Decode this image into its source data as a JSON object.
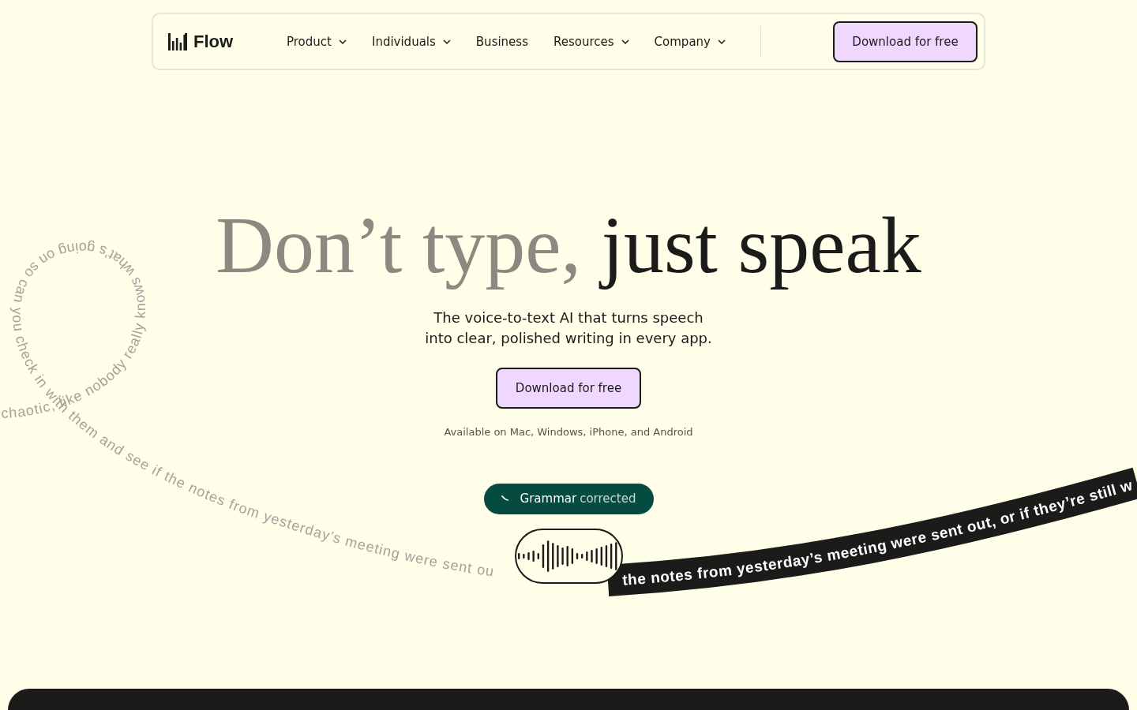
{
  "nav": {
    "logo": "Flow",
    "items": [
      {
        "label": "Product",
        "dropdown": true
      },
      {
        "label": "Individuals",
        "dropdown": true
      },
      {
        "label": "Business",
        "dropdown": false
      },
      {
        "label": "Resources",
        "dropdown": true
      },
      {
        "label": "Company",
        "dropdown": true
      }
    ],
    "cta": "Download for free"
  },
  "hero": {
    "title_muted": "Don’t type,",
    "title_strong": "just speak",
    "subtitle_lines": [
      "The voice-to-text AI that turns speech",
      "into clear, polished writing in every app."
    ],
    "cta": "Download for free",
    "availability": "Available on Mac, Windows, iPhone, and Android"
  },
  "demo": {
    "badge": {
      "label": "Grammar",
      "status": "corrected"
    },
    "raw_text": "chaotic, like nobody really knows what’s going on so can you check in with them and see if the notes from yesterday’s meeting were sent ou",
    "polished_text": "the notes from yesterday’s meeting were sent out, or if they’re still w"
  }
}
